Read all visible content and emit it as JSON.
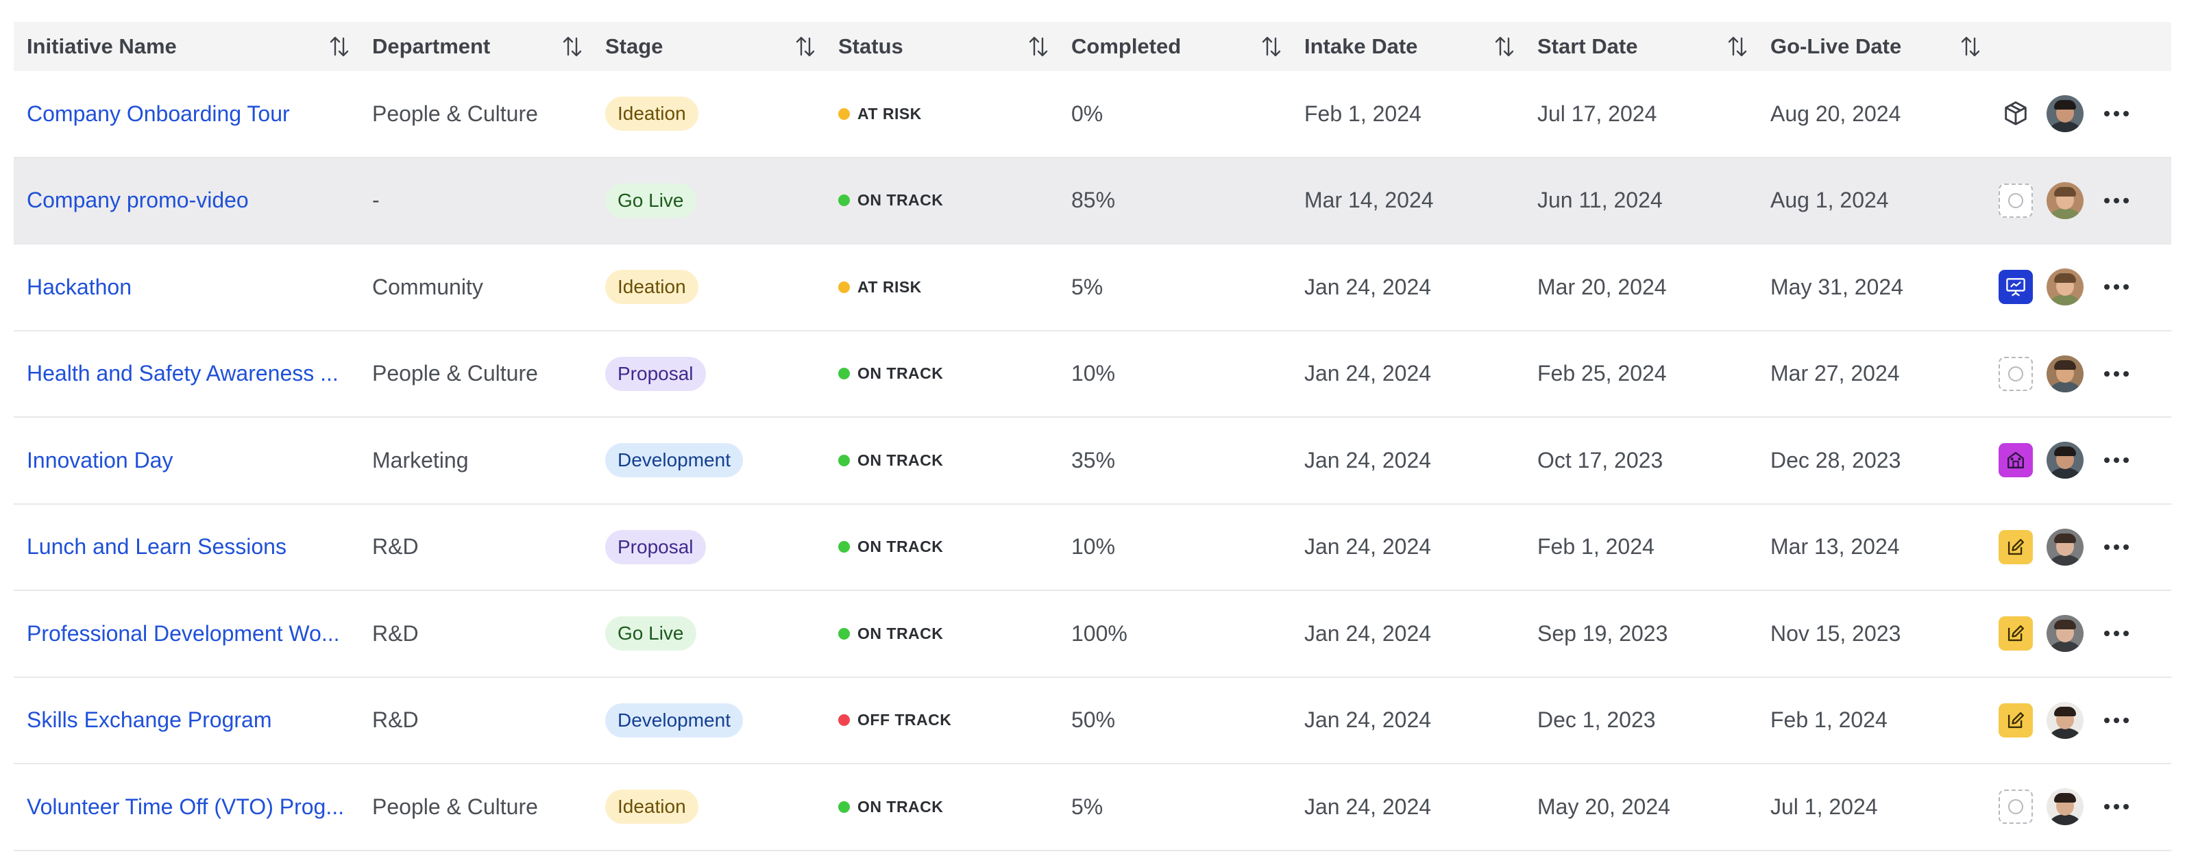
{
  "columns": [
    {
      "label": "Initiative Name"
    },
    {
      "label": "Department"
    },
    {
      "label": "Stage"
    },
    {
      "label": "Status"
    },
    {
      "label": "Completed"
    },
    {
      "label": "Intake Date"
    },
    {
      "label": "Start Date"
    },
    {
      "label": "Go-Live Date"
    }
  ],
  "colors": {
    "link": "#1f50d8",
    "at_risk": "#f7b928",
    "on_track": "#3fc93f",
    "off_track": "#f0454f",
    "selected_row": "#ececee"
  },
  "rows": [
    {
      "name": "Company Onboarding Tour",
      "department": "People & Culture",
      "stage": "Ideation",
      "stage_kind": "ideation",
      "status": "AT RISK",
      "status_kind": "at_risk",
      "completed": "0%",
      "intake": "Feb 1, 2024",
      "start": "Jul 17, 2024",
      "golive": "Aug 20, 2024",
      "icon": "cube-icon",
      "avatar": "dark-hair-man"
    },
    {
      "name": "Company promo-video",
      "department": "-",
      "stage": "Go Live",
      "stage_kind": "golive",
      "status": "ON TRACK",
      "status_kind": "on_track",
      "completed": "85%",
      "intake": "Mar 14, 2024",
      "start": "Jun 11, 2024",
      "golive": "Aug 1, 2024",
      "icon": "empty-icon",
      "avatar": "curly-hair-man"
    },
    {
      "name": "Hackathon",
      "department": "Community",
      "stage": "Ideation",
      "stage_kind": "ideation",
      "status": "AT RISK",
      "status_kind": "at_risk",
      "completed": "5%",
      "intake": "Jan 24, 2024",
      "start": "Mar 20, 2024",
      "golive": "May 31, 2024",
      "icon": "presentation-icon",
      "avatar": "curly-hair-man"
    },
    {
      "name": "Health and Safety Awareness ...",
      "department": "People & Culture",
      "stage": "Proposal",
      "stage_kind": "proposal",
      "status": "ON TRACK",
      "status_kind": "on_track",
      "completed": "10%",
      "intake": "Jan 24, 2024",
      "start": "Feb 25, 2024",
      "golive": "Mar 27, 2024",
      "icon": "empty-icon",
      "avatar": "glasses-man"
    },
    {
      "name": "Innovation Day",
      "department": "Marketing",
      "stage": "Development",
      "stage_kind": "development",
      "status": "ON TRACK",
      "status_kind": "on_track",
      "completed": "35%",
      "intake": "Jan 24, 2024",
      "start": "Oct 17, 2023",
      "golive": "Dec 28, 2023",
      "icon": "building-icon",
      "avatar": "dark-hair-man"
    },
    {
      "name": "Lunch and Learn Sessions",
      "department": "R&D",
      "stage": "Proposal",
      "stage_kind": "proposal",
      "status": "ON TRACK",
      "status_kind": "on_track",
      "completed": "10%",
      "intake": "Jan 24, 2024",
      "start": "Feb 1, 2024",
      "golive": "Mar 13, 2024",
      "icon": "edit-icon",
      "avatar": "long-hair-woman"
    },
    {
      "name": "Professional Development Wo...",
      "department": "R&D",
      "stage": "Go Live",
      "stage_kind": "golive",
      "status": "ON TRACK",
      "status_kind": "on_track",
      "completed": "100%",
      "intake": "Jan 24, 2024",
      "start": "Sep 19, 2023",
      "golive": "Nov 15, 2023",
      "icon": "edit-icon",
      "avatar": "long-hair-woman"
    },
    {
      "name": "Skills Exchange Program",
      "department": "R&D",
      "stage": "Development",
      "stage_kind": "development",
      "status": "OFF TRACK",
      "status_kind": "off_track",
      "completed": "50%",
      "intake": "Jan 24, 2024",
      "start": "Dec 1, 2023",
      "golive": "Feb 1, 2024",
      "icon": "edit-icon",
      "avatar": "bearded-man"
    },
    {
      "name": "Volunteer Time Off (VTO) Prog...",
      "department": "People & Culture",
      "stage": "Ideation",
      "stage_kind": "ideation",
      "status": "ON TRACK",
      "status_kind": "on_track",
      "completed": "5%",
      "intake": "Jan 24, 2024",
      "start": "May 20, 2024",
      "golive": "Jul 1, 2024",
      "icon": "empty-icon",
      "avatar": "bearded-man"
    }
  ],
  "selected_row": 1
}
